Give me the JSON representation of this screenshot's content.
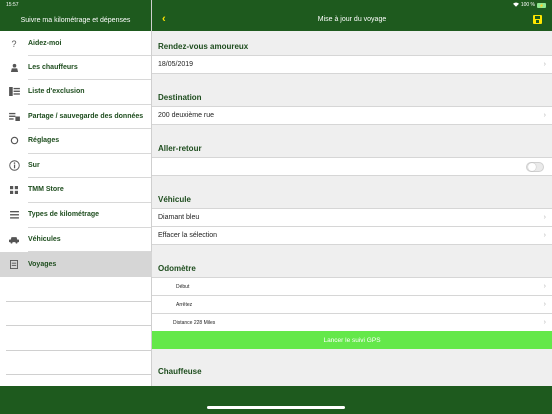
{
  "status": {
    "time": "15:57",
    "battery_percent": "100 %"
  },
  "sidebar": {
    "title": "Suivre ma kilométrage et dépenses",
    "items": [
      {
        "label": "Aidez-moi",
        "icon": "help-icon"
      },
      {
        "label": "Les chauffeurs",
        "icon": "driver-icon"
      },
      {
        "label": "Liste d'exclusion",
        "icon": "exclusion-list-icon"
      },
      {
        "label": "Partage / sauvegarde des données",
        "icon": "share-backup-icon"
      },
      {
        "label": "Réglages",
        "icon": "settings-icon"
      },
      {
        "label": "Sur",
        "icon": "info-icon"
      },
      {
        "label": "TMM Store",
        "icon": "store-icon"
      },
      {
        "label": "Types de kilométrage",
        "icon": "mileage-types-icon"
      },
      {
        "label": "Véhicules",
        "icon": "car-icon"
      },
      {
        "label": "Voyages",
        "icon": "trips-icon"
      }
    ],
    "active_index": 9
  },
  "main": {
    "title": "Mise à jour du voyage",
    "sections": {
      "date_title": "Rendez-vous amoureux",
      "date_value": "18/05/2019",
      "destination_title": "Destination",
      "destination_value": "200 deuxième rue",
      "round_trip_title": "Aller-retour",
      "round_trip_on": false,
      "vehicle_title": "Véhicule",
      "vehicle_value": "Diamant bleu",
      "clear_selection": "Effacer la sélection",
      "odometer_title": "Odomètre",
      "odo_start": "Début",
      "odo_stop": "Arrêtez",
      "odo_distance": "Distance  228 Miles",
      "gps_button": "Lancer le suivi GPS",
      "driver_title": "Chauffeuse"
    }
  },
  "colors": {
    "header": "#1e5a1e",
    "accent": "#ffe600",
    "gps": "#64e84a"
  }
}
